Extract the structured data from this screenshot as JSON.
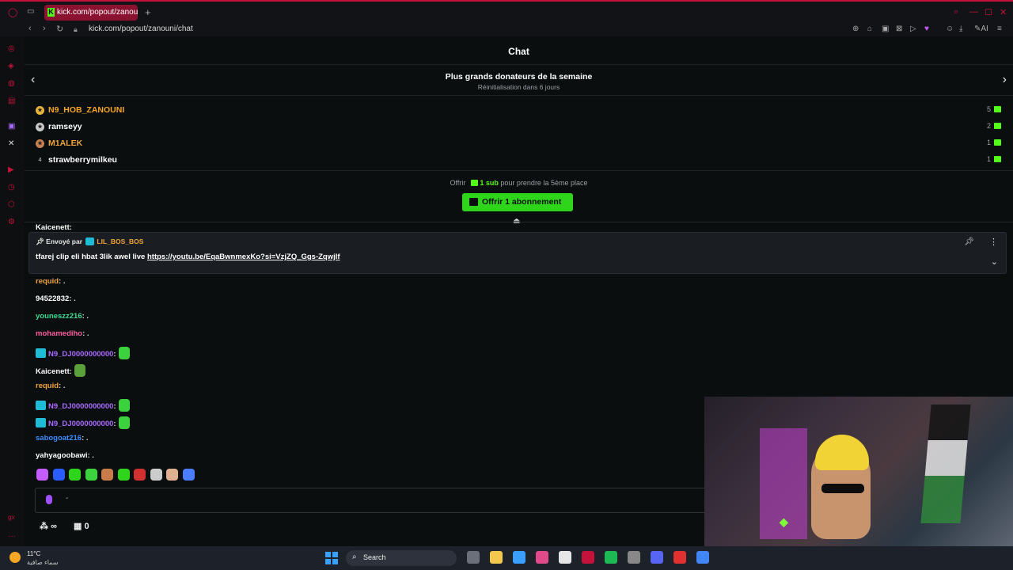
{
  "browser": {
    "tab_title": "kick.com/popout/zanouni/",
    "url": "kick.com/popout/zanouni/chat",
    "ai_label": "AI"
  },
  "chat": {
    "header_title": "Chat",
    "donors": {
      "title": "Plus grands donateurs de la semaine",
      "subtitle": "Réinitialisation dans 6 jours",
      "list": [
        {
          "rank": "1",
          "name": "N9_HOB_ZANOUNI",
          "count": "5",
          "color": "#f5a623",
          "medal": "#e9b43a"
        },
        {
          "rank": "2",
          "name": "ramseyy",
          "count": "2",
          "color": "#ffffff",
          "medal": "#c9c9c9"
        },
        {
          "rank": "3",
          "name": "M1ALEK",
          "count": "1",
          "color": "#f0a53a",
          "medal": "#c7814f"
        },
        {
          "rank": "4",
          "name": "strawberrymilkeu",
          "count": "1",
          "color": "#ffffff",
          "medal": ""
        }
      ]
    },
    "offer": {
      "prefix": "Offrir",
      "sub_label": "1 sub",
      "suffix": "pour prendre la 5ème place",
      "button": "Offrir 1 abonnement"
    },
    "partial_line": "Kaicenett:",
    "pinned": {
      "sent_by": "Envoyé par",
      "user": "LIL_BOS_BOS",
      "text": "tfarej clip eli hbat 3lik awel live",
      "link": "https://youtu.be/EqaBwnmexKo?si=VzjZQ_Ggs-Zqwjlf"
    },
    "messages": [
      {
        "user": "requid",
        "color": "#f0a53a",
        "text": ":  .",
        "badge": false,
        "emote": ""
      },
      {
        "user": "94522832",
        "color": "#ffffff",
        "text": ":  .",
        "badge": false,
        "emote": ""
      },
      {
        "user": "youneszz216",
        "color": "#3ddc97",
        "text": ":  .",
        "badge": false,
        "emote": ""
      },
      {
        "user": "mohamediho",
        "color": "#ff5fa2",
        "text": ":  .",
        "badge": false,
        "emote": ""
      },
      {
        "user": "N9_DJ0000000000",
        "color": "#a86bff",
        "text": ":",
        "badge": true,
        "emote": "#3bd23d"
      },
      {
        "user": "Kaicenett",
        "color": "#ffffff",
        "text": ":",
        "badge": false,
        "emote": "#5aa03c"
      },
      {
        "user": "requid",
        "color": "#f0a53a",
        "text": ":  .",
        "badge": false,
        "emote": ""
      },
      {
        "user": "N9_DJ0000000000",
        "color": "#a86bff",
        "text": ":",
        "badge": true,
        "emote": "#3bd23d"
      },
      {
        "user": "N9_DJ0000000000",
        "color": "#a86bff",
        "text": ":",
        "badge": true,
        "emote": "#3bd23d"
      },
      {
        "user": "sabogoat216",
        "color": "#3a8dff",
        "text": ":  .",
        "badge": false,
        "emote": ""
      },
      {
        "user": "yahyagoobawi",
        "color": "#ffffff",
        "text": ":  .",
        "badge": false,
        "emote": ""
      }
    ],
    "emote_colors": [
      "#c45cff",
      "#2a5cff",
      "#2ed51a",
      "#3bd23d",
      "#c97b4a",
      "#2ed51a",
      "#d03030",
      "#cccccc",
      "#e0b090",
      "#4a7dff"
    ],
    "input": {
      "placeholder": "-"
    },
    "points": "∞",
    "gift_count": "0"
  },
  "taskbar": {
    "temp": "11°C",
    "weather_text": "سماء صافية",
    "search_label": "Search",
    "app_colors": [
      "#6a6f7a",
      "#f2c94c",
      "#3aa0ff",
      "#e04a8a",
      "#e6e6e6",
      "#c4123b",
      "#1db954",
      "#888888",
      "#5865f2",
      "#e03030",
      "#4285f4"
    ]
  }
}
